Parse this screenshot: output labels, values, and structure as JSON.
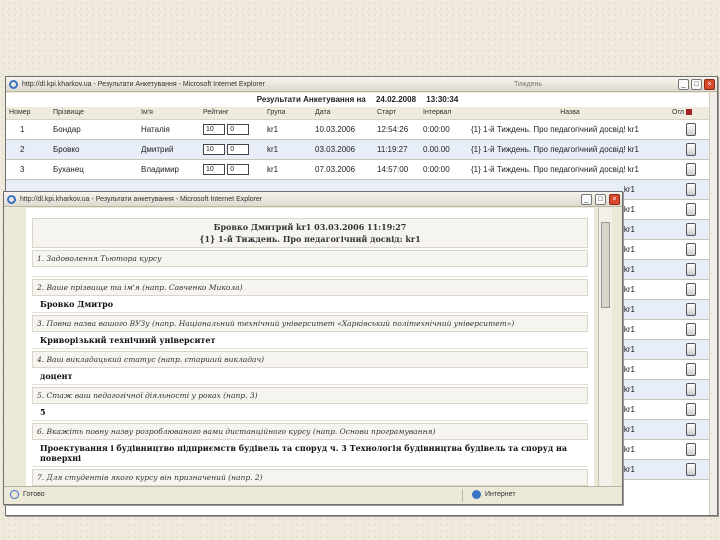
{
  "back_window": {
    "title": "http://dl.kpi.kharkov.ua - Результати Анкетування - Microsoft Internet Explorer",
    "partial_tab": "Тиждень",
    "results_label": "Результати Анкетування на",
    "results_date": "24.02.2008",
    "results_time": "13:30:34",
    "columns": [
      "Номер",
      "Прізвище",
      "Ім'я",
      "Рейтинг",
      "Група",
      "Дата",
      "Старт",
      "Інтервал",
      "Назва",
      "Огл"
    ],
    "rows": [
      {
        "num": "1",
        "surname": "Бондар",
        "name": "Наталія",
        "rating1": "10",
        "rating2": "0",
        "group": "kr1",
        "date": "10.03.2006",
        "start": "12:54:26",
        "interval": "0:00:00",
        "title": "{1} 1-й Тиждень. Про педагогічний досвід! kr1"
      },
      {
        "num": "2",
        "surname": "Бровко",
        "name": "Дмитрий",
        "rating1": "10",
        "rating2": "0",
        "group": "kr1",
        "date": "03.03.2006",
        "start": "11:19:27",
        "interval": "0.00.00",
        "title": "{1} 1-й Тиждень. Про педагогічний досвід! kr1"
      },
      {
        "num": "3",
        "surname": "Буханец",
        "name": "Владимир",
        "rating1": "10",
        "rating2": "0",
        "group": "kr1",
        "date": "07.03.2006",
        "start": "14:57:00",
        "interval": "0:00:00",
        "title": "{1} 1-й Тиждень. Про педагогічний досвід! kr1"
      }
    ],
    "partial_row_titles": [
      "kr1",
      "kr1",
      "kr1",
      "kr1",
      "kr1",
      "kr1",
      "kr1",
      "kr1",
      "kr1",
      "kr1",
      "kr1",
      "kr1",
      "kr1",
      "kr1",
      "kr1"
    ]
  },
  "front_window": {
    "title": "http://dl.kpi.kharkov.ua - Результати анкетування - Microsoft Internet Explorer",
    "header_line1": "Бровко Дмитрий kr1 03.03.2006 11:19:27",
    "header_line2": "{1} 1-й Тиждень. Про педагогічний досвід: kr1",
    "questions": [
      {
        "q": "1. Задоволення Тьютора курсу",
        "a": ""
      },
      {
        "q": "2. Ваше прізвище та ім'я (напр. Савченко Микола)",
        "a": "Бровко Дмитро"
      },
      {
        "q": "3. Повна назва вашого ВУЗу (напр. Національний технічний університет «Харківський політехнічний університет»)",
        "a": "Криворізький технічний університет"
      },
      {
        "q": "4. Ваш викладацький статус (напр. старший викладач)",
        "a": "доцент"
      },
      {
        "q": "5. Стаж ваш педагогічної діяльності у роках (напр. 3)",
        "a": "5"
      },
      {
        "q": "6. Вкажіть повну назву розроблюваного вами дистанційного курсу (напр. Основи програмування)",
        "a": "Проектування і будівництво підприємств будівель та споруд ч. 3 Технологія будівництва будівель та споруд на поверхні"
      },
      {
        "q": "7. Для студентів якого курсу він призначений (напр. 2)",
        "a": ""
      }
    ],
    "status_left": "Готово",
    "status_zone": "Интернет"
  }
}
